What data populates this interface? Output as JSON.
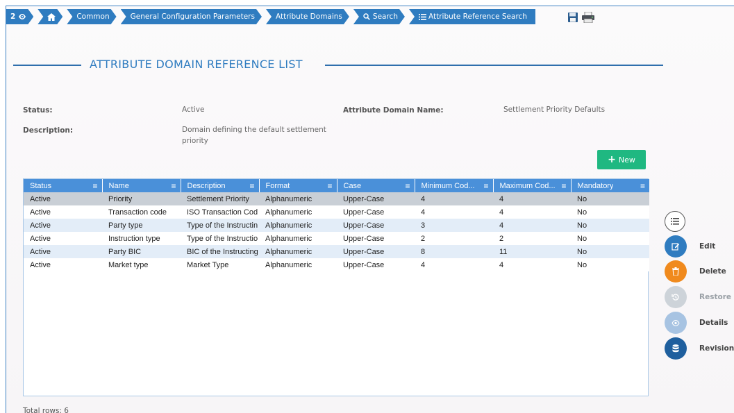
{
  "breadcrumb": {
    "count": "2",
    "items": [
      "Common",
      "General Configuration Parameters",
      "Attribute Domains",
      "Search",
      "Attribute Reference Search"
    ]
  },
  "page_title": "ATTRIBUTE DOMAIN REFERENCE LIST",
  "fields": {
    "status_label": "Status:",
    "status_value": "Active",
    "domain_name_label": "Attribute Domain Name:",
    "domain_name_value": "Settlement Priority Defaults",
    "description_label": "Description:",
    "description_value": "Domain defining the default settlement priority"
  },
  "new_button": "New",
  "table": {
    "columns": [
      "Status",
      "Name",
      "Description",
      "Format",
      "Case",
      "Minimum Cod...",
      "Maximum Cod...",
      "Mandatory"
    ],
    "rows": [
      [
        "Active",
        "Priority",
        "Settlement Priority",
        "Alphanumeric",
        "Upper-Case",
        "4",
        "4",
        "No"
      ],
      [
        "Active",
        "Transaction code",
        "ISO Transaction Cod",
        "Alphanumeric",
        "Upper-Case",
        "4",
        "4",
        "No"
      ],
      [
        "Active",
        "Party type",
        "Type of the Instructin",
        "Alphanumeric",
        "Upper-Case",
        "3",
        "4",
        "No"
      ],
      [
        "Active",
        "Instruction type",
        "Type of the Instructio",
        "Alphanumeric",
        "Upper-Case",
        "2",
        "2",
        "No"
      ],
      [
        "Active",
        "Party BIC",
        "BIC of the Instructing",
        "Alphanumeric",
        "Upper-Case",
        "8",
        "11",
        "No"
      ],
      [
        "Active",
        "Market type",
        "Market Type",
        "Alphanumeric",
        "Upper-Case",
        "4",
        "4",
        "No"
      ]
    ]
  },
  "total_rows": "Total rows: 6",
  "actions": [
    {
      "label": "",
      "icon": "list-icon",
      "color": "#ffffff"
    },
    {
      "label": "Edit",
      "icon": "edit-icon",
      "color": "#2f7cc0"
    },
    {
      "label": "Delete",
      "icon": "trash-icon",
      "color": "#f08a1d"
    },
    {
      "label": "Restore",
      "icon": "restore-icon",
      "color": "#cdd3d9"
    },
    {
      "label": "Details",
      "icon": "eye-icon",
      "color": "#a7c3e2"
    },
    {
      "label": "Revisions",
      "icon": "database-icon",
      "color": "#1f5f9e"
    }
  ],
  "colors": {
    "primary": "#2f7cc0",
    "header": "#4a90d9",
    "new_button": "#1fb881",
    "row_alt": "#e3edf8",
    "row_selected": "#c9cfd6"
  }
}
